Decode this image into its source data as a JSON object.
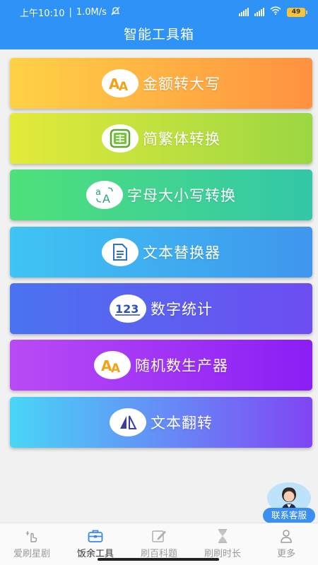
{
  "status_bar": {
    "time": "上午10:10",
    "divider": "|",
    "speed": "1.0M/s",
    "battery": "49"
  },
  "header": {
    "title": "智能工具箱"
  },
  "tools": [
    {
      "label": "金额转大写",
      "icon": "aa-icon",
      "gradient": [
        "#ffd246",
        "#ff9140"
      ]
    },
    {
      "label": "简繁体转换",
      "icon": "traditional-char-icon",
      "gradient": [
        "#e3ea3a",
        "#9bd743"
      ]
    },
    {
      "label": "字母大小写转换",
      "icon": "letter-case-icon",
      "gradient": [
        "#4fe07a",
        "#33c7a8"
      ]
    },
    {
      "label": "文本替换器",
      "icon": "document-icon",
      "gradient": [
        "#3fc4f3",
        "#3f96ee"
      ]
    },
    {
      "label": "数字统计",
      "icon": "number-123-icon",
      "gradient": [
        "#4a73f0",
        "#6e4df1"
      ]
    },
    {
      "label": "随机数生产器",
      "icon": "aa-icon",
      "gradient": [
        "#b94bf5",
        "#8a1ef5"
      ]
    },
    {
      "label": "文本翻转",
      "icon": "flip-icon",
      "gradient": [
        "#49d6f6",
        "#8145f5"
      ]
    }
  ],
  "service": {
    "label": "联系客服"
  },
  "tabbar": [
    {
      "label": "爱刷星剧",
      "icon": "sparkle-hand-icon",
      "active": false
    },
    {
      "label": "饭余工具",
      "icon": "toolbox-icon",
      "active": true
    },
    {
      "label": "刷百科题",
      "icon": "edit-icon",
      "active": false
    },
    {
      "label": "刷刷时长",
      "icon": "hourglass-icon",
      "active": false
    },
    {
      "label": "更多",
      "icon": "user-icon",
      "active": false
    }
  ]
}
